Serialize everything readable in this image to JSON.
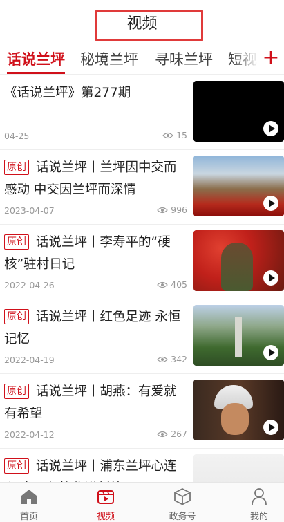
{
  "header": {
    "title": "视频"
  },
  "tabs": {
    "items": [
      "话说兰坪",
      "秘境兰坪",
      "寻味兰坪",
      "短视"
    ],
    "active_index": 0,
    "add_label": "+"
  },
  "badge_label": "原创",
  "list": [
    {
      "title": "《话说兰坪》第277期",
      "original": false,
      "date": "04-25",
      "views": "15"
    },
    {
      "title": "话说兰坪丨兰坪因中交而感动 中交因兰坪而深情",
      "original": true,
      "date": "2023-04-07",
      "views": "996"
    },
    {
      "title": "话说兰坪丨李寿平的“硬核”驻村日记",
      "original": true,
      "date": "2022-04-26",
      "views": "405"
    },
    {
      "title": "话说兰坪丨红色足迹 永恒记忆",
      "original": true,
      "date": "2022-04-19",
      "views": "342"
    },
    {
      "title": "话说兰坪丨胡燕：有爱就有希望",
      "original": true,
      "date": "2022-04-12",
      "views": "267"
    },
    {
      "title": "话说兰坪丨浦东兰坪心连心 东西部协作谱新篇",
      "original": true,
      "date": "",
      "views": ""
    }
  ],
  "bottom_nav": {
    "home": "首页",
    "video": "视频",
    "gov": "政务号",
    "mine": "我的"
  },
  "colors": {
    "accent": "#d0101a",
    "title_box": "#e03a3a"
  }
}
